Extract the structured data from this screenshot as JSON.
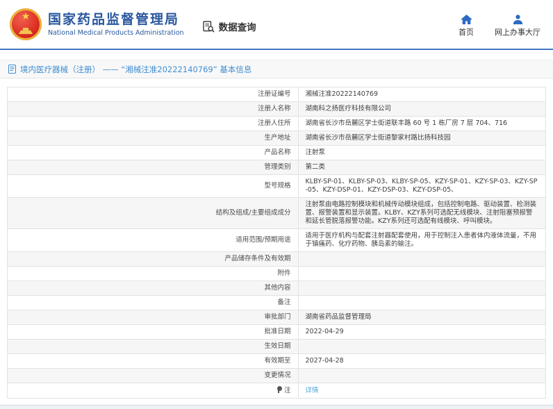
{
  "header": {
    "agency_name_cn": "国家药品监督管理局",
    "agency_name_en": "National Medical Products Administration",
    "section_title": "数据查询",
    "nav": [
      {
        "label": "首页",
        "icon": "home-icon"
      },
      {
        "label": "网上办事大厅",
        "icon": "user-icon"
      }
    ]
  },
  "breadcrumb": {
    "icon": "document-icon",
    "text": "境内医疗器械（注册） —— “湘械注准20222140769” 基本信息"
  },
  "table": {
    "rows": [
      {
        "label": "注册证编号",
        "value": "湘械注准20222140769"
      },
      {
        "label": "注册人名称",
        "value": "湖南科之扬医疗科技有限公司"
      },
      {
        "label": "注册人住所",
        "value": "湖南省长沙市岳麓区学士街道联丰路 60 号 1 栋厂房 7 层 704、716"
      },
      {
        "label": "生产地址",
        "value": "湖南省长沙市岳麓区学士街道黎家村路比扬科技园"
      },
      {
        "label": "产品名称",
        "value": "注射泵"
      },
      {
        "label": "管理类别",
        "value": "第二类"
      },
      {
        "label": "型号规格",
        "value": "KLBY-SP-01、KLBY-SP-03、KLBY-SP-05、KZY-SP-01、KZY-SP-03、KZY-SP-05、KZY-DSP-01、KZY-DSP-03、KZY-DSP-05、"
      },
      {
        "label": "结构及组成/主要组成成分",
        "value": "注射泵由电路控制模块和机械传动模块组成，包括控制电路、驱动装置、检测装置、报警装置和显示装置。KLBY、KZY系列可选配无线模块、注射阻塞预报警和延长管脱落报警功能。KZY系列还可选配有线模块、呼叫模块。"
      },
      {
        "label": "适用范围/预期用途",
        "value": "适用于医疗机构与配套注射器配套使用，用于控制注入患者体内液体流量，不用于镇痛药、化疗药物、胰岛素的输注。"
      },
      {
        "label": "产品储存条件及有效期",
        "value": ""
      },
      {
        "label": "附件",
        "value": ""
      },
      {
        "label": "其他内容",
        "value": ""
      },
      {
        "label": "备注",
        "value": ""
      },
      {
        "label": "审批部门",
        "value": "湖南省药品监督管理局"
      },
      {
        "label": "批准日期",
        "value": "2022-04-29"
      },
      {
        "label": "生效日期",
        "value": ""
      },
      {
        "label": "有效期至",
        "value": "2027-04-28"
      },
      {
        "label": "变更情况",
        "value": ""
      },
      {
        "label": "注",
        "value": "详情",
        "link": true,
        "label_icon": "note-icon"
      }
    ]
  },
  "colors": {
    "title_blue": "#29579e",
    "header_line_blue": "#4077bf",
    "nav_icon_blue": "#2c6bc4",
    "breadcrumb_blue": "#3d8dd1",
    "link_blue": "#4aa2de",
    "emblem_red": "#d8261c",
    "emblem_gold": "#e9b43c",
    "table_border": "#e2e2e2",
    "zebra_gray": "#f6f6f6"
  }
}
